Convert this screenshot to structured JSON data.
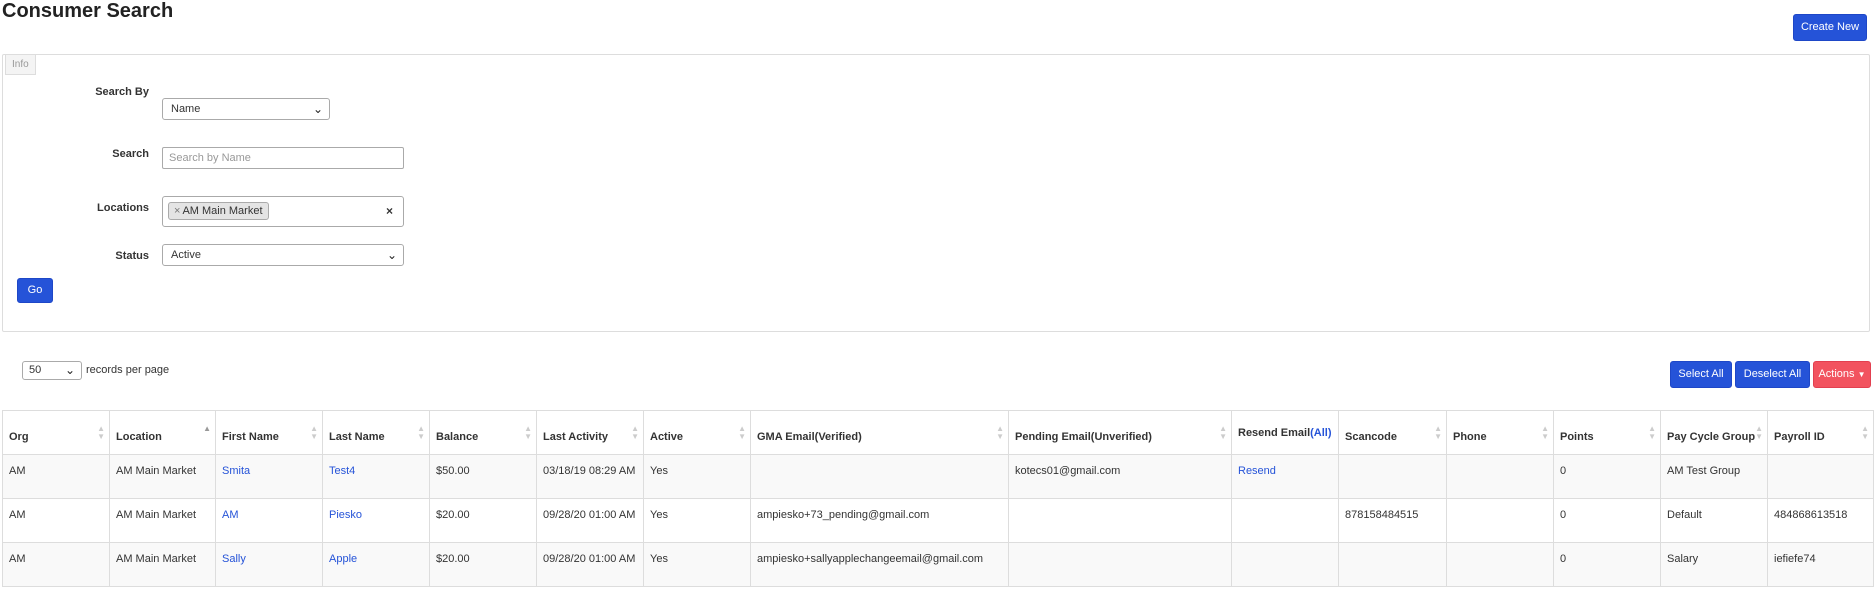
{
  "page": {
    "title": "Consumer Search",
    "create_label": "Create New"
  },
  "panel": {
    "tag": "Info"
  },
  "form": {
    "search_by": {
      "label": "Search By",
      "value": "Name"
    },
    "search": {
      "label": "Search",
      "placeholder": "Search by Name"
    },
    "locations": {
      "label": "Locations",
      "chips": [
        "AM Main Market"
      ]
    },
    "status": {
      "label": "Status",
      "value": "Active"
    },
    "go_label": "Go"
  },
  "pager": {
    "per_page": "50",
    "label": "records per page"
  },
  "actions": {
    "select_all": "Select All",
    "deselect_all": "Deselect All",
    "actions": "Actions"
  },
  "table": {
    "columns": [
      "Org",
      "Location",
      "First Name",
      "Last Name",
      "Balance",
      "Last Activity",
      "Active",
      "GMA Email(Verified)",
      "Pending Email(Unverified)",
      "Resend Email",
      "Scancode",
      "Phone",
      "Points",
      "Pay Cycle Group",
      "Payroll ID"
    ],
    "resend_all": "(All)",
    "rows": [
      {
        "org": "AM",
        "location": "AM Main Market",
        "first": "Smita",
        "last": "Test4",
        "balance": "$50.00",
        "activity": "03/18/19 08:29 AM",
        "active": "Yes",
        "gma_email": "",
        "pending_email": "kotecs01@gmail.com",
        "resend": "Resend",
        "scancode": "",
        "phone": "",
        "points": "0",
        "pay_cycle": "AM Test Group",
        "payroll": ""
      },
      {
        "org": "AM",
        "location": "AM Main Market",
        "first": "AM",
        "last": "Piesko",
        "balance": "$20.00",
        "activity": "09/28/20 01:00 AM",
        "active": "Yes",
        "gma_email": "ampiesko+73_pending@gmail.com",
        "pending_email": "",
        "resend": "",
        "scancode": "878158484515",
        "phone": "",
        "points": "0",
        "pay_cycle": "Default",
        "payroll": "484868613518"
      },
      {
        "org": "AM",
        "location": "AM Main Market",
        "first": "Sally",
        "last": "Apple",
        "balance": "$20.00",
        "activity": "09/28/20 01:00 AM",
        "active": "Yes",
        "gma_email": "ampiesko+sallyapplechangeemail@gmail.com",
        "pending_email": "",
        "resend": "",
        "scancode": "",
        "phone": "",
        "points": "0",
        "pay_cycle": "Salary",
        "payroll": "iefiefe74"
      }
    ]
  },
  "colors": {
    "primary": "#2553d8",
    "danger": "#f2535f",
    "link": "#2553d8"
  }
}
